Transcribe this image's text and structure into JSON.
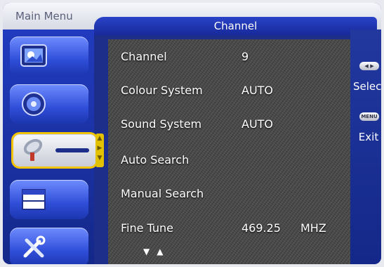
{
  "header": {
    "main_menu": "Main Menu",
    "title": "Channel"
  },
  "sidebar": {
    "items": [
      {
        "name": "picture",
        "icon": "picture-icon"
      },
      {
        "name": "sound",
        "icon": "speaker-icon"
      },
      {
        "name": "channel",
        "icon": "satellite-dish-icon",
        "active": true
      },
      {
        "name": "function",
        "icon": "window-icon"
      },
      {
        "name": "setup",
        "icon": "tools-icon"
      }
    ],
    "scroll_up": "▲",
    "scroll_right": "▶",
    "scroll_down": "▼"
  },
  "menu": {
    "rows": [
      {
        "label": "Channel",
        "value": "9"
      },
      {
        "label": "Colour System",
        "value": "AUTO"
      },
      {
        "label": "Sound System",
        "value": "AUTO"
      },
      {
        "label": "Auto Search",
        "value": ""
      },
      {
        "label": "Manual Search",
        "value": ""
      },
      {
        "label": "Fine Tune",
        "value": "469.25",
        "unit": "MHZ"
      }
    ],
    "nav_arrows": "▼▲"
  },
  "help": {
    "select_key": "◀ ▶",
    "select_label": "Select",
    "menu_key": "MENU",
    "exit_label": "Exit"
  },
  "colors": {
    "frame_blue": "#1d2e8a",
    "active_border": "#f2c400",
    "text": "#ffffff"
  }
}
